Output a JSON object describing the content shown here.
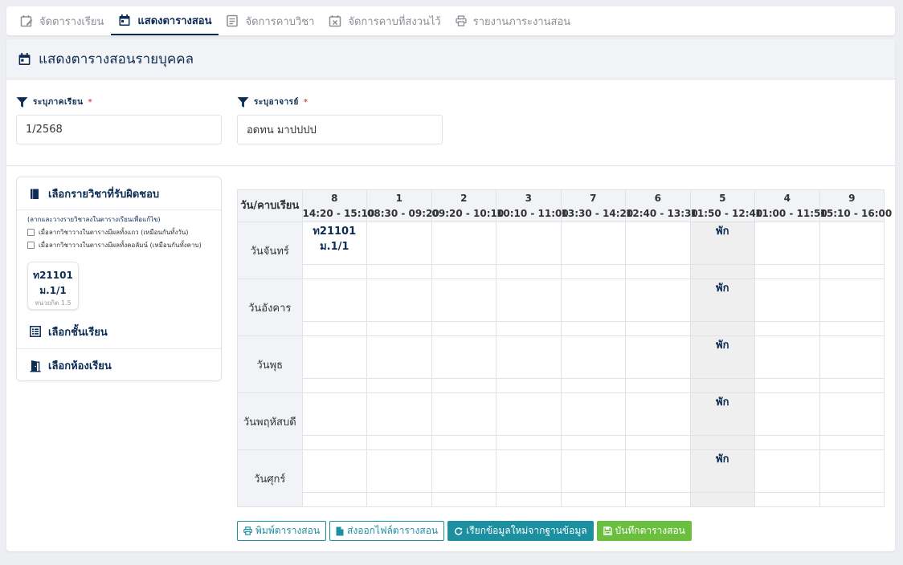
{
  "tabs": [
    {
      "label": "จัดตารางเรียน",
      "icon": "edit-calendar-icon",
      "active": false
    },
    {
      "label": "แสดงตารางสอน",
      "icon": "calendar-icon",
      "active": true
    },
    {
      "label": "จัดการคาบวิชา",
      "icon": "list-icon",
      "active": false
    },
    {
      "label": "จัดการคาบที่สงวนไว้",
      "icon": "calendar-x-icon",
      "active": false
    },
    {
      "label": "รายงานภาระงานสอน",
      "icon": "printer-icon",
      "active": false
    }
  ],
  "page": {
    "title": "แสดงตารางสอนรายบุคคล"
  },
  "filters": {
    "term": {
      "label": "ระบุภาคเรียน",
      "required": "*",
      "value": "1/2568"
    },
    "teacher": {
      "label": "ระบุอาจารย์",
      "required": "*",
      "value": "อดทน มาปปปป"
    }
  },
  "panel": {
    "subjects_title": "เลือกรายวิชาที่รับผิดชอบ",
    "hint": "(ลากและวางรายวิชาลงในตารางเรียนเพื่อแก้ไข)",
    "option_row": "เมื่อลากวิชาวางในตารางมีผลทั้งแถว (เหมือนกันทั้งวัน)",
    "option_col": "เมื่อลากวิชาวางในตารางมีผลทั้งคอลัมน์ (เหมือนกันทั้งคาบ)",
    "course": {
      "code": "ท21101",
      "room": "ม.1/1",
      "credit": "หน่วยกิต 1.5"
    },
    "classes_title": "เลือกชั้นเรียน",
    "rooms_title": "เลือกห้องเรียน"
  },
  "timetable": {
    "corner": "วัน/คาบเรียน",
    "periods": [
      {
        "num": "8",
        "time": "14:20 - 15:10"
      },
      {
        "num": "1",
        "time": "08:30 - 09:20"
      },
      {
        "num": "2",
        "time": "09:20 - 10:10"
      },
      {
        "num": "3",
        "time": "10:10 - 11:00"
      },
      {
        "num": "7",
        "time": "13:30 - 14:20"
      },
      {
        "num": "6",
        "time": "12:40 - 13:30"
      },
      {
        "num": "5",
        "time": "11:50 - 12:40"
      },
      {
        "num": "4",
        "time": "11:00 - 11:50"
      },
      {
        "num": "9",
        "time": "15:10 - 16:00"
      }
    ],
    "break_label": "พัก",
    "break_period_index": 6,
    "days": [
      {
        "name": "วันจันทร์",
        "cells": [
          "ท21101\nม.1/1",
          "",
          "",
          "",
          "",
          "",
          "พัก",
          "",
          ""
        ]
      },
      {
        "name": "วันอังคาร",
        "cells": [
          "",
          "",
          "",
          "",
          "",
          "",
          "พัก",
          "",
          ""
        ]
      },
      {
        "name": "วันพุธ",
        "cells": [
          "",
          "",
          "",
          "",
          "",
          "",
          "พัก",
          "",
          ""
        ]
      },
      {
        "name": "วันพฤหัสบดี",
        "cells": [
          "",
          "",
          "",
          "",
          "",
          "",
          "พัก",
          "",
          ""
        ]
      },
      {
        "name": "วันศุกร์",
        "cells": [
          "",
          "",
          "",
          "",
          "",
          "",
          "พัก",
          "",
          ""
        ]
      }
    ]
  },
  "buttons": {
    "print": "พิมพ์ตารางสอน",
    "export": "ส่งออกไฟล์ตารางสอน",
    "reload": "เรียกข้อมูลใหม่จากฐานข้อมูล",
    "save": "บันทึกตารางสอน"
  },
  "colors": {
    "primary": "#0d2c54",
    "teal": "#1c8fa0",
    "green": "#6bbf3f",
    "required": "#d9534f",
    "break_bg": "#efefef"
  }
}
